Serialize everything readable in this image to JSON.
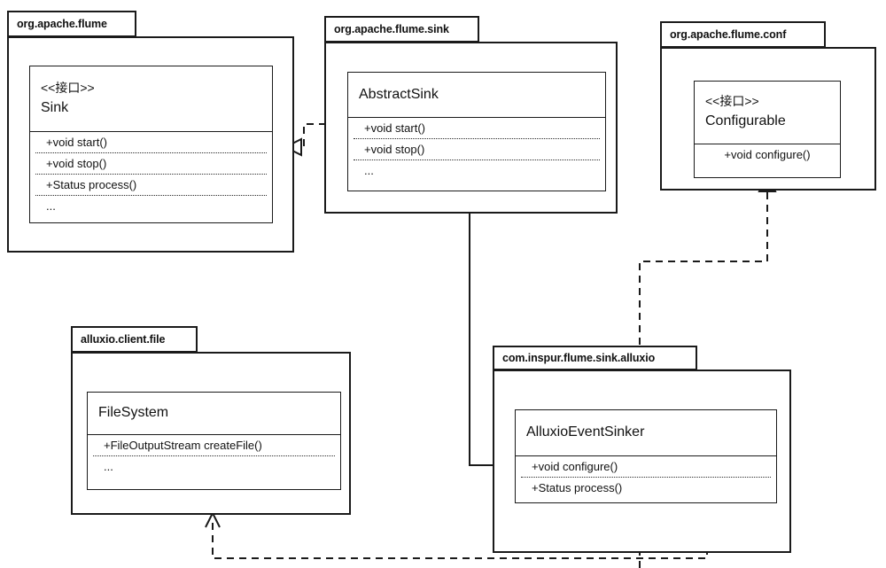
{
  "diagram": {
    "title": "UML class diagram",
    "stroke_color": "#1a1a1a",
    "background": "#ffffff"
  },
  "packages": [
    {
      "id": "org-apache-flume",
      "label": "org.apache.flume",
      "classes": [
        {
          "id": "sink",
          "stereotype": "<<接口>>",
          "name": "Sink",
          "operations": [
            "+void start()",
            "+void stop()",
            "+Status process()",
            "..."
          ]
        }
      ]
    },
    {
      "id": "org-apache-flume-sink",
      "label": "org.apache.flume.sink",
      "classes": [
        {
          "id": "abstractsink",
          "stereotype": "",
          "name": "AbstractSink",
          "operations": [
            "+void start()",
            "+void stop()",
            "..."
          ]
        }
      ]
    },
    {
      "id": "org-apache-flume-conf",
      "label": "org.apache.flume.conf",
      "classes": [
        {
          "id": "configurable",
          "stereotype": "<<接口>>",
          "name": "Configurable",
          "operations": [
            "+void configure()"
          ]
        }
      ]
    },
    {
      "id": "alluxio-client-file",
      "label": "alluxio.client.file",
      "classes": [
        {
          "id": "filesystem",
          "stereotype": "",
          "name": "FileSystem",
          "operations": [
            "+FileOutputStream createFile()",
            "..."
          ]
        }
      ]
    },
    {
      "id": "com-inspur-flume-sink-alluxio",
      "label": "com.inspur.flume.sink.alluxio",
      "classes": [
        {
          "id": "alluxioeventsinker",
          "stereotype": "",
          "name": "AlluxioEventSinker",
          "operations": [
            "+void configure()",
            "+Status process()"
          ]
        }
      ]
    }
  ],
  "relations": [
    {
      "id": "abstractsink-realizes-sink",
      "type": "realization",
      "from": "abstractsink",
      "to": "sink",
      "style": "dashed",
      "arrowhead": "hollow-triangle"
    },
    {
      "id": "alluxioeventsinker-extends-abstractsink",
      "type": "generalization",
      "from": "alluxioeventsinker",
      "to": "abstractsink",
      "style": "solid",
      "arrowhead": "hollow-triangle"
    },
    {
      "id": "alluxioeventsinker-realizes-configurable",
      "type": "realization",
      "from": "alluxioeventsinker",
      "to": "configurable",
      "style": "dashed",
      "arrowhead": "hollow-triangle"
    },
    {
      "id": "alluxioeventsinker-depends-filesystem",
      "type": "dependency",
      "from": "alluxioeventsinker",
      "to": "filesystem",
      "style": "dashed",
      "arrowhead": "open-arrow"
    }
  ]
}
